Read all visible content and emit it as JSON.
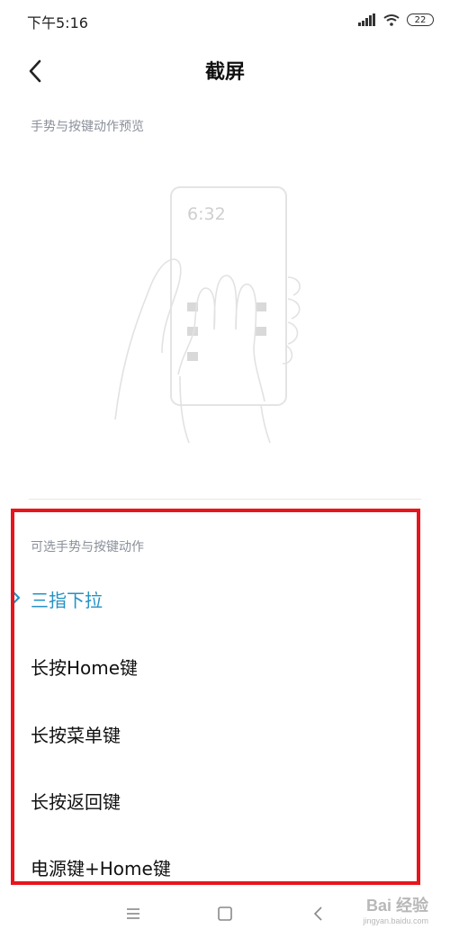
{
  "status_bar": {
    "time": "下午5:16",
    "battery": "22",
    "icons": [
      "signal-icon",
      "wifi-icon",
      "battery-icon"
    ]
  },
  "header": {
    "title": "截屏",
    "back_icon": "chevron-left-icon"
  },
  "preview_section": {
    "label": "手势与按键动作预览",
    "phone_clock": "6:32"
  },
  "options_section": {
    "label": "可选手势与按键动作",
    "items": [
      {
        "label": "三指下拉",
        "selected": true
      },
      {
        "label": "长按Home键",
        "selected": false
      },
      {
        "label": "长按菜单键",
        "selected": false
      },
      {
        "label": "长按返回键",
        "selected": false
      },
      {
        "label": "电源键+Home键",
        "selected": false
      }
    ],
    "accent_color": "#2592c4",
    "highlight_color": "#e8141c"
  },
  "nav_bar": {
    "icons": [
      "menu-icon",
      "home-square-icon",
      "back-chevron-icon"
    ]
  },
  "watermark": {
    "brand": "Bai 经验",
    "url": "jingyan.baidu.com"
  }
}
